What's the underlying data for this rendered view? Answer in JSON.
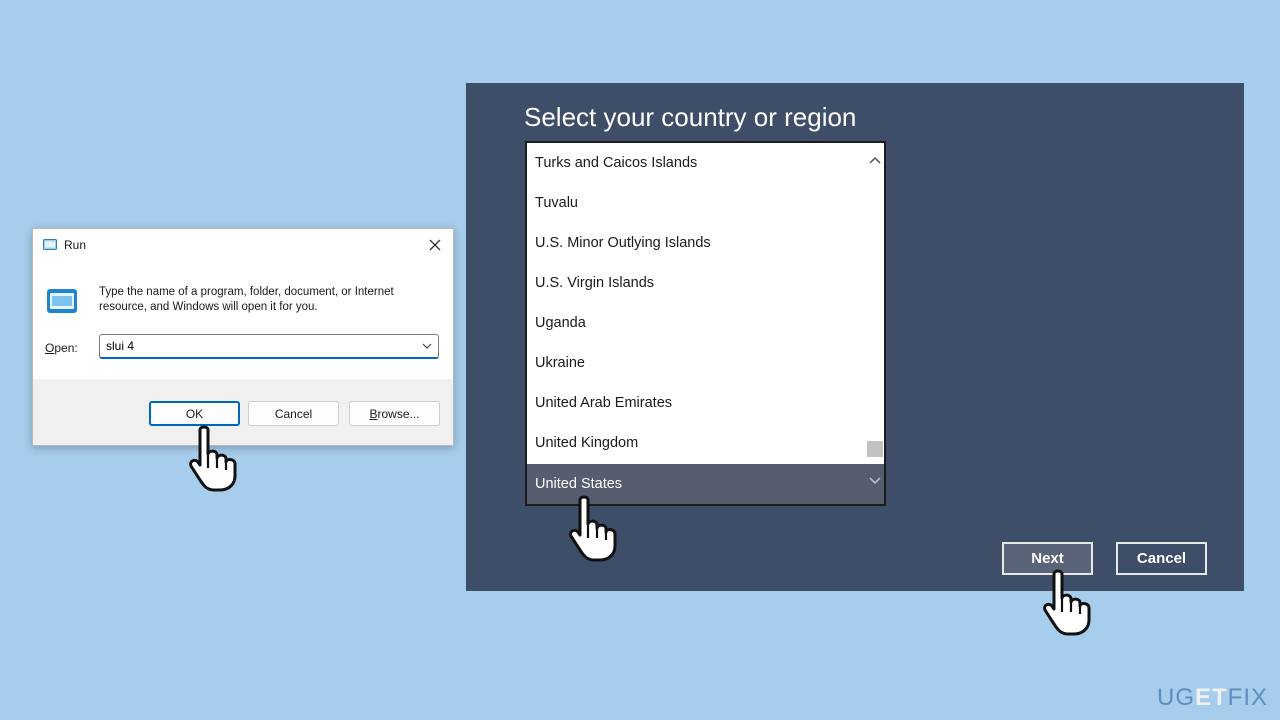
{
  "run_dialog": {
    "title": "Run",
    "description": "Type the name of a program, folder, document, or Internet resource, and Windows will open it for you.",
    "open_label_mnemonic": "O",
    "open_label_rest": "pen:",
    "open_value": "slui 4",
    "ok_label": "OK",
    "cancel_label": "Cancel",
    "browse_mnemonic": "B",
    "browse_rest": "rowse..."
  },
  "region_dialog": {
    "heading": "Select your country or region",
    "items": [
      "Turks and Caicos Islands",
      "Tuvalu",
      "U.S. Minor Outlying Islands",
      "U.S. Virgin Islands",
      "Uganda",
      "Ukraine",
      "United Arab Emirates",
      "United Kingdom",
      "United States"
    ],
    "selected": "United States",
    "next_label": "Next",
    "cancel_label": "Cancel"
  },
  "watermark": {
    "part1": "UG",
    "part2": "ET",
    "part3": "FIX"
  },
  "colors": {
    "background": "#a6cdec",
    "region_panel": "#3e4d68",
    "selection": "#555d6e",
    "ok_focus": "#0067c0"
  }
}
